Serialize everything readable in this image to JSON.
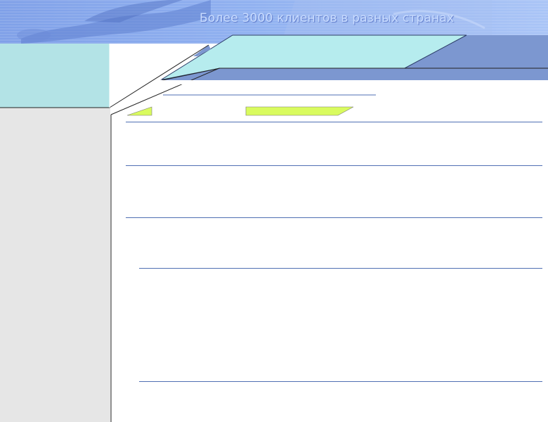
{
  "header": {
    "tagline": "Более 3000 клиентов в разных странах"
  },
  "colors": {
    "banner_blue": "#8fb0f0",
    "sidebar_panel": "#b3e3e6",
    "sidebar_gray": "#e6e6e6",
    "tab_aqua": "#b6ecee",
    "tab_navy": "#7c97d0",
    "tab_green": "#d9fb5e",
    "divider": "#4f6fb3"
  },
  "icons": [
    "swimmer-illustration"
  ]
}
